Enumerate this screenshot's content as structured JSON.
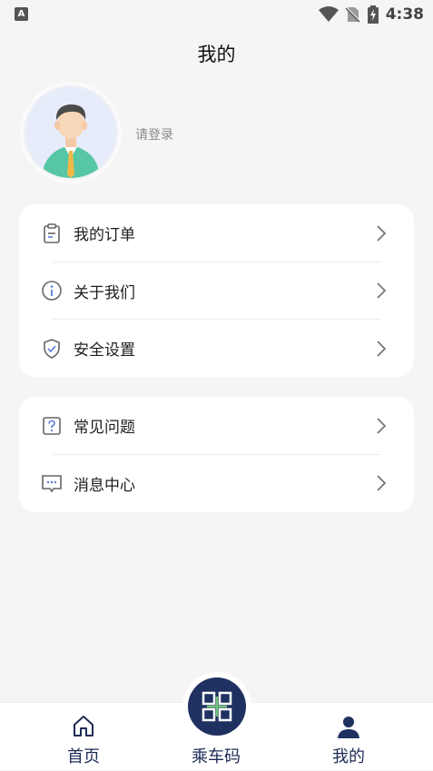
{
  "status_bar": {
    "app_icon_letter": "A",
    "time": "4:38"
  },
  "header": {
    "title": "我的"
  },
  "profile": {
    "login_prompt": "请登录"
  },
  "menu_group_1": [
    {
      "label": "我的订单",
      "icon": "clipboard-icon"
    },
    {
      "label": "关于我们",
      "icon": "info-icon"
    },
    {
      "label": "安全设置",
      "icon": "shield-icon"
    }
  ],
  "menu_group_2": [
    {
      "label": "常见问题",
      "icon": "question-icon"
    },
    {
      "label": "消息中心",
      "icon": "message-icon"
    }
  ],
  "tab_bar": {
    "home_label": "首页",
    "code_label": "乘车码",
    "mine_label": "我的",
    "active_color": "#1f3160"
  }
}
